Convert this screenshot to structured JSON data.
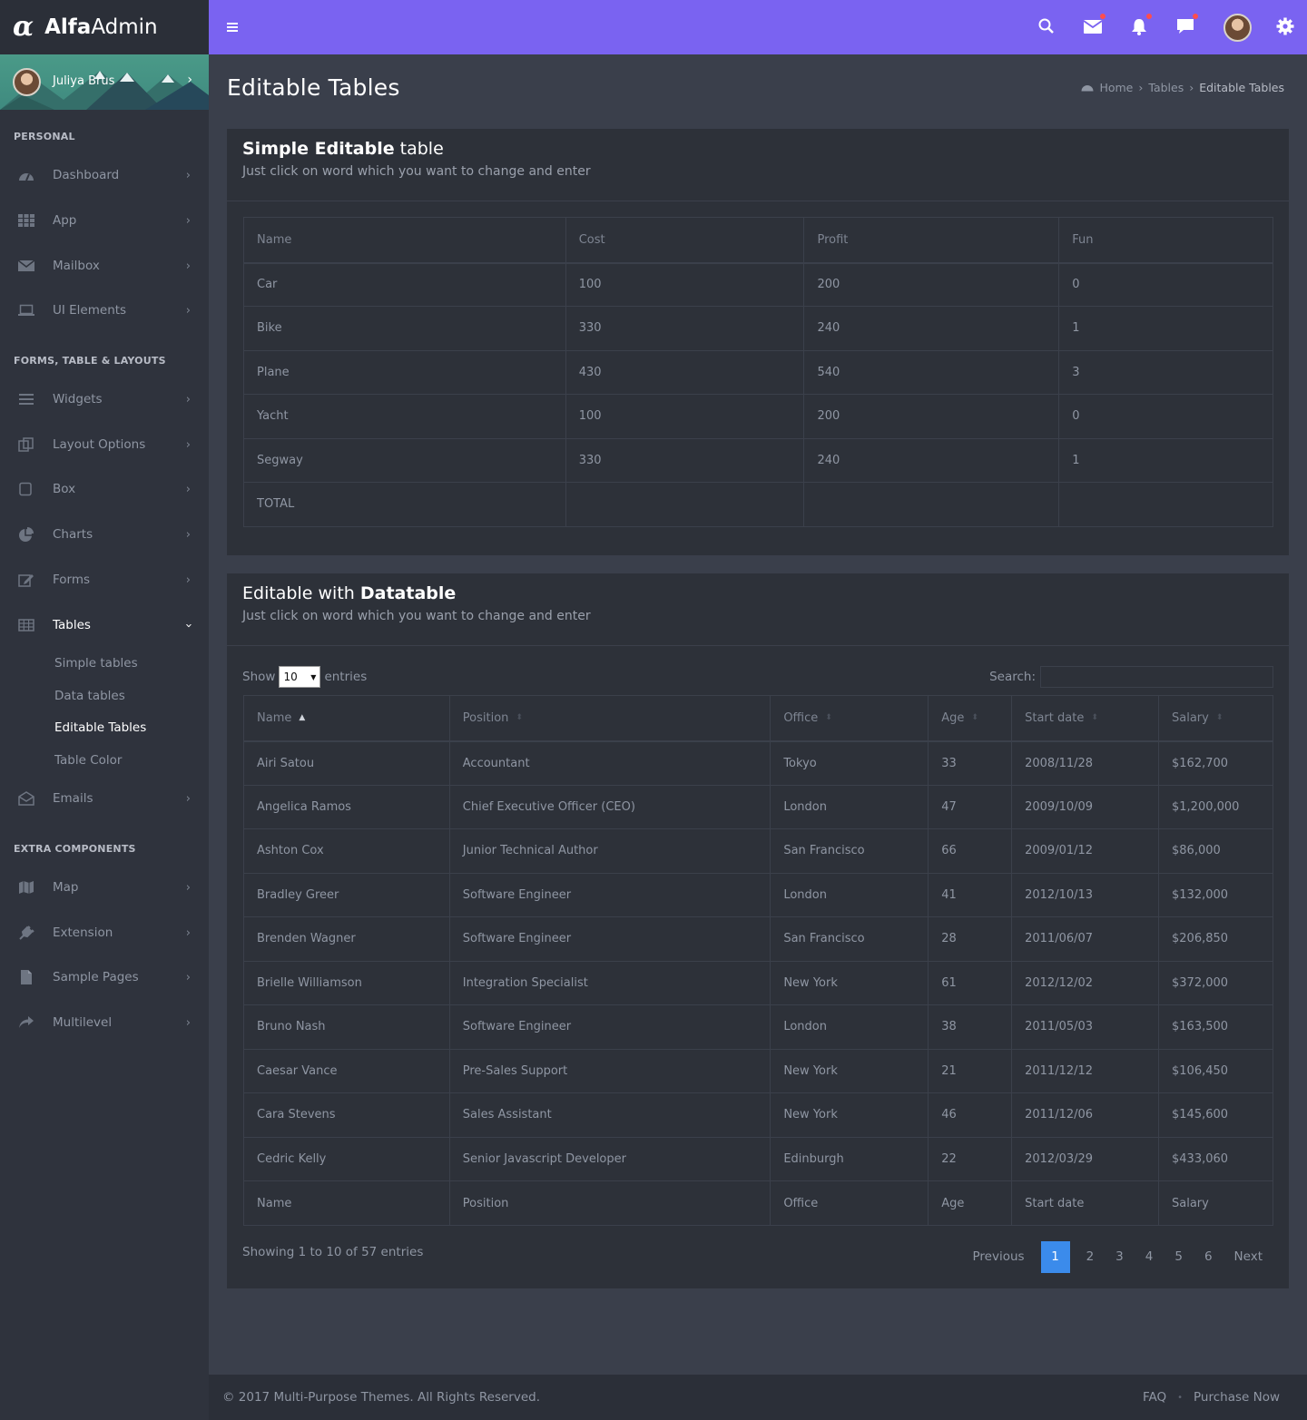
{
  "app": {
    "logo_mark": "α",
    "brand_bold": "Alfa",
    "brand_light": "Admin"
  },
  "user": {
    "name": "Juliya Brus"
  },
  "sidebar": {
    "sections": [
      "PERSONAL",
      "FORMS, TABLE & LAYOUTS",
      "EXTRA COMPONENTS"
    ],
    "items": [
      {
        "label": "Dashboard",
        "icon": "dashboard-icon"
      },
      {
        "label": "App",
        "icon": "grid-icon"
      },
      {
        "label": "Mailbox",
        "icon": "envelope-icon"
      },
      {
        "label": "UI Elements",
        "icon": "laptop-icon"
      },
      {
        "label": "Widgets",
        "icon": "bars-icon"
      },
      {
        "label": "Layout Options",
        "icon": "copy-icon"
      },
      {
        "label": "Box",
        "icon": "square-icon"
      },
      {
        "label": "Charts",
        "icon": "pie-chart-icon"
      },
      {
        "label": "Forms",
        "icon": "edit-icon"
      },
      {
        "label": "Tables",
        "icon": "table-icon"
      },
      {
        "label": "Emails",
        "icon": "envelope-open-icon"
      },
      {
        "label": "Map",
        "icon": "map-icon"
      },
      {
        "label": "Extension",
        "icon": "plug-icon"
      },
      {
        "label": "Sample Pages",
        "icon": "file-icon"
      },
      {
        "label": "Multilevel",
        "icon": "share-icon"
      }
    ],
    "tables_sub": [
      "Simple tables",
      "Data tables",
      "Editable Tables",
      "Table Color"
    ]
  },
  "page": {
    "title": "Editable Tables",
    "breadcrumb": [
      "Home",
      "Tables",
      "Editable Tables"
    ]
  },
  "box1": {
    "title_bold": "Simple Editable",
    "title_rest": " table",
    "subtitle": "Just click on word which you want to change and enter",
    "columns": [
      "Name",
      "Cost",
      "Profit",
      "Fun"
    ],
    "rows": [
      [
        "Car",
        "100",
        "200",
        "0"
      ],
      [
        "Bike",
        "330",
        "240",
        "1"
      ],
      [
        "Plane",
        "430",
        "540",
        "3"
      ],
      [
        "Yacht",
        "100",
        "200",
        "0"
      ],
      [
        "Segway",
        "330",
        "240",
        "1"
      ],
      [
        "TOTAL",
        "",
        "",
        ""
      ]
    ]
  },
  "box2": {
    "title_pre": "Editable with ",
    "title_bold": "Datatable",
    "subtitle": "Just click on word which you want to change and enter",
    "show_label": "Show",
    "entries_value": "10",
    "entries_label": "entries",
    "search_label": "Search:",
    "columns": [
      "Name",
      "Position",
      "Office",
      "Age",
      "Start date",
      "Salary"
    ],
    "rows": [
      [
        "Airi Satou",
        "Accountant",
        "Tokyo",
        "33",
        "2008/11/28",
        "$162,700"
      ],
      [
        "Angelica Ramos",
        "Chief Executive Officer (CEO)",
        "London",
        "47",
        "2009/10/09",
        "$1,200,000"
      ],
      [
        "Ashton Cox",
        "Junior Technical Author",
        "San Francisco",
        "66",
        "2009/01/12",
        "$86,000"
      ],
      [
        "Bradley Greer",
        "Software Engineer",
        "London",
        "41",
        "2012/10/13",
        "$132,000"
      ],
      [
        "Brenden Wagner",
        "Software Engineer",
        "San Francisco",
        "28",
        "2011/06/07",
        "$206,850"
      ],
      [
        "Brielle Williamson",
        "Integration Specialist",
        "New York",
        "61",
        "2012/12/02",
        "$372,000"
      ],
      [
        "Bruno Nash",
        "Software Engineer",
        "London",
        "38",
        "2011/05/03",
        "$163,500"
      ],
      [
        "Caesar Vance",
        "Pre-Sales Support",
        "New York",
        "21",
        "2011/12/12",
        "$106,450"
      ],
      [
        "Cara Stevens",
        "Sales Assistant",
        "New York",
        "46",
        "2011/12/06",
        "$145,600"
      ],
      [
        "Cedric Kelly",
        "Senior Javascript Developer",
        "Edinburgh",
        "22",
        "2012/03/29",
        "$433,060"
      ]
    ],
    "footer_columns": [
      "Name",
      "Position",
      "Office",
      "Age",
      "Start date",
      "Salary"
    ],
    "info": "Showing 1 to 10 of 57 entries",
    "pagination": {
      "previous": "Previous",
      "pages": [
        "1",
        "2",
        "3",
        "4",
        "5",
        "6"
      ],
      "current": "1",
      "next": "Next"
    }
  },
  "footer": {
    "copyright": "© 2017 Multi-Purpose Themes. All Rights Reserved.",
    "links": [
      "FAQ",
      "Purchase Now"
    ]
  },
  "colors": {
    "topbar": "#7a63f1",
    "accent": "#3b8beb",
    "notification_dot": "#ff4d4d"
  }
}
